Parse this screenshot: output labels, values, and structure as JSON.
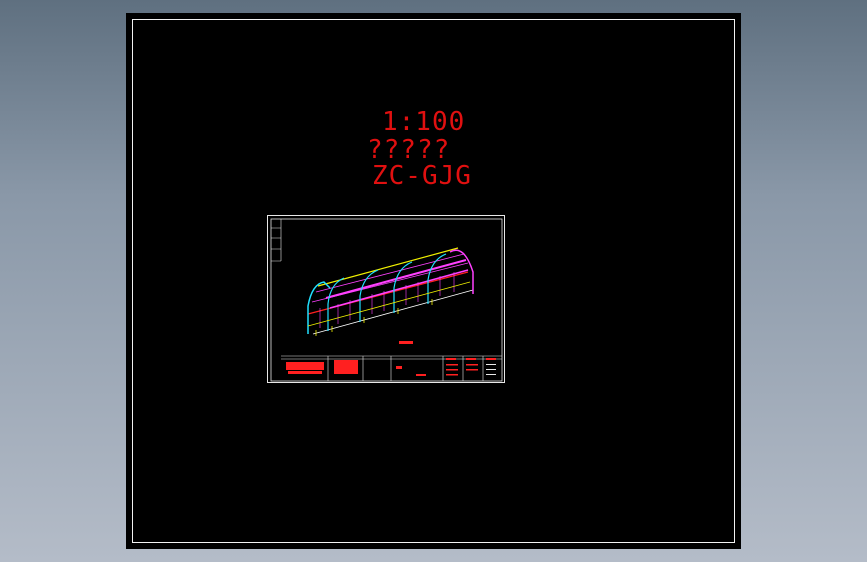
{
  "canvas": {
    "background": "#000000",
    "frame_color": "#f2f2f2"
  },
  "labels": {
    "scale": "1:100",
    "title_mojibake": "?????",
    "code": "ZC-GJG",
    "color": "#e01010"
  },
  "drawing": {
    "type": "isometric greenhouse steel frame",
    "colors": {
      "frame": "#ff2020",
      "magenta": "#ff40ff",
      "cyan": "#20e0ff",
      "yellow": "#f0f000",
      "white": "#ffffff"
    }
  }
}
